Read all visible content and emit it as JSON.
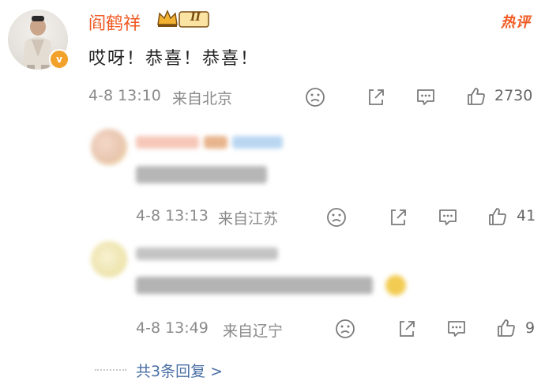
{
  "comment": {
    "author": "阎鹤祥",
    "badge_text": "II",
    "hot_label": "热评",
    "text": "哎呀！恭喜！恭喜！",
    "time": "4-8 13:10",
    "source": "来自北京",
    "like_count": "2730"
  },
  "replies": [
    {
      "time": "4-8 13:13",
      "source": "来自江苏",
      "like_count": "41"
    },
    {
      "time": "4-8 13:49",
      "source": "来自辽宁",
      "like_count": "9"
    }
  ],
  "more_replies": "共3条回复 >",
  "colors": {
    "accent": "#f15a22",
    "link": "#4a6fa5",
    "meta": "#8a8a8a"
  },
  "icons": [
    "sad-face-icon",
    "share-icon",
    "comment-icon",
    "thumbs-up-icon",
    "verified-icon",
    "crown-icon"
  ]
}
